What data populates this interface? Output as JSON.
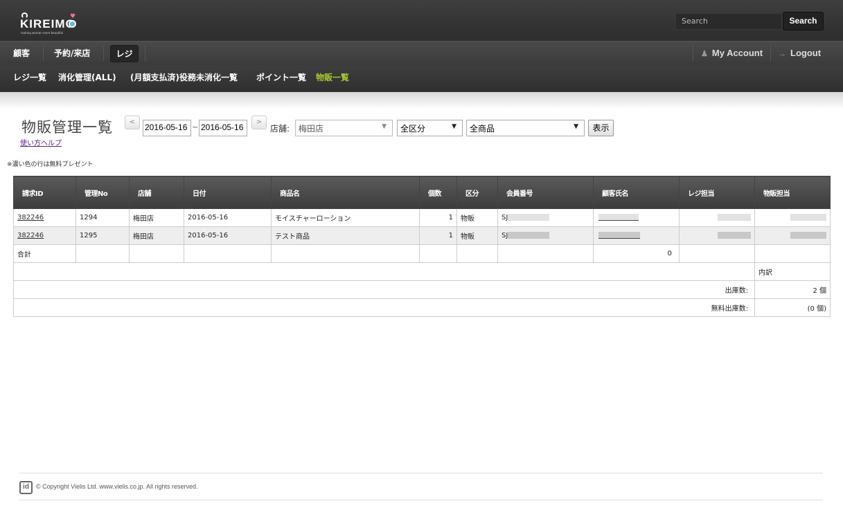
{
  "header": {
    "logo_text": "KIREIMO",
    "logo_tagline": "making woman more beautiful",
    "search_placeholder": "Search",
    "search_button": "Search"
  },
  "main_nav": {
    "items": [
      "顧客",
      "予約/来店",
      "レジ"
    ],
    "active": "レジ",
    "my_account": "My Account",
    "logout": "Logout"
  },
  "sub_nav": {
    "items": [
      "レジ一覧",
      "消化管理(ALL)",
      "(月額支払済)役務未消化一覧",
      "ポイント一覧",
      "物販一覧"
    ],
    "active": "物販一覧"
  },
  "filters": {
    "page_title": "物販管理一覧",
    "help_link": "使い方ヘルプ",
    "prev_arrow": "<",
    "next_arrow": ">",
    "date_from": "2016-05-16",
    "date_tilde": "~",
    "date_to": "2016-05-16",
    "store_label": "店舗:",
    "store_value": "梅田店",
    "category_value": "全区分",
    "product_value": "全商品",
    "show_button": "表示"
  },
  "note": "※濃い色の行は無料プレゼント",
  "table": {
    "columns": [
      "請求ID",
      "管理No",
      "店舗",
      "日付",
      "商品名",
      "個数",
      "区分",
      "会員番号",
      "顧客氏名",
      "レジ担当",
      "物販担当"
    ],
    "rows": [
      {
        "id": "382246",
        "mgmt_no": "1294",
        "store": "梅田店",
        "date": "2016-05-16",
        "product": "モイスチャーローション",
        "qty": "1",
        "category": "物販",
        "member_prefix": "SJ"
      },
      {
        "id": "382246",
        "mgmt_no": "1295",
        "store": "梅田店",
        "date": "2016-05-16",
        "product": "テスト商品",
        "qty": "1",
        "category": "物販",
        "member_prefix": "SJ"
      }
    ],
    "total_label": "合計",
    "total_value": "0",
    "breakdown_label": "内訳",
    "shipped_label": "出庫数:",
    "shipped_value": "2 個",
    "free_label": "無料出庫数:",
    "free_value": "(0 個)"
  },
  "footer": {
    "logo": "id",
    "copyright": "© Copyright Vielis Ltd. www.vielis.co.jp. All rights reserved."
  }
}
